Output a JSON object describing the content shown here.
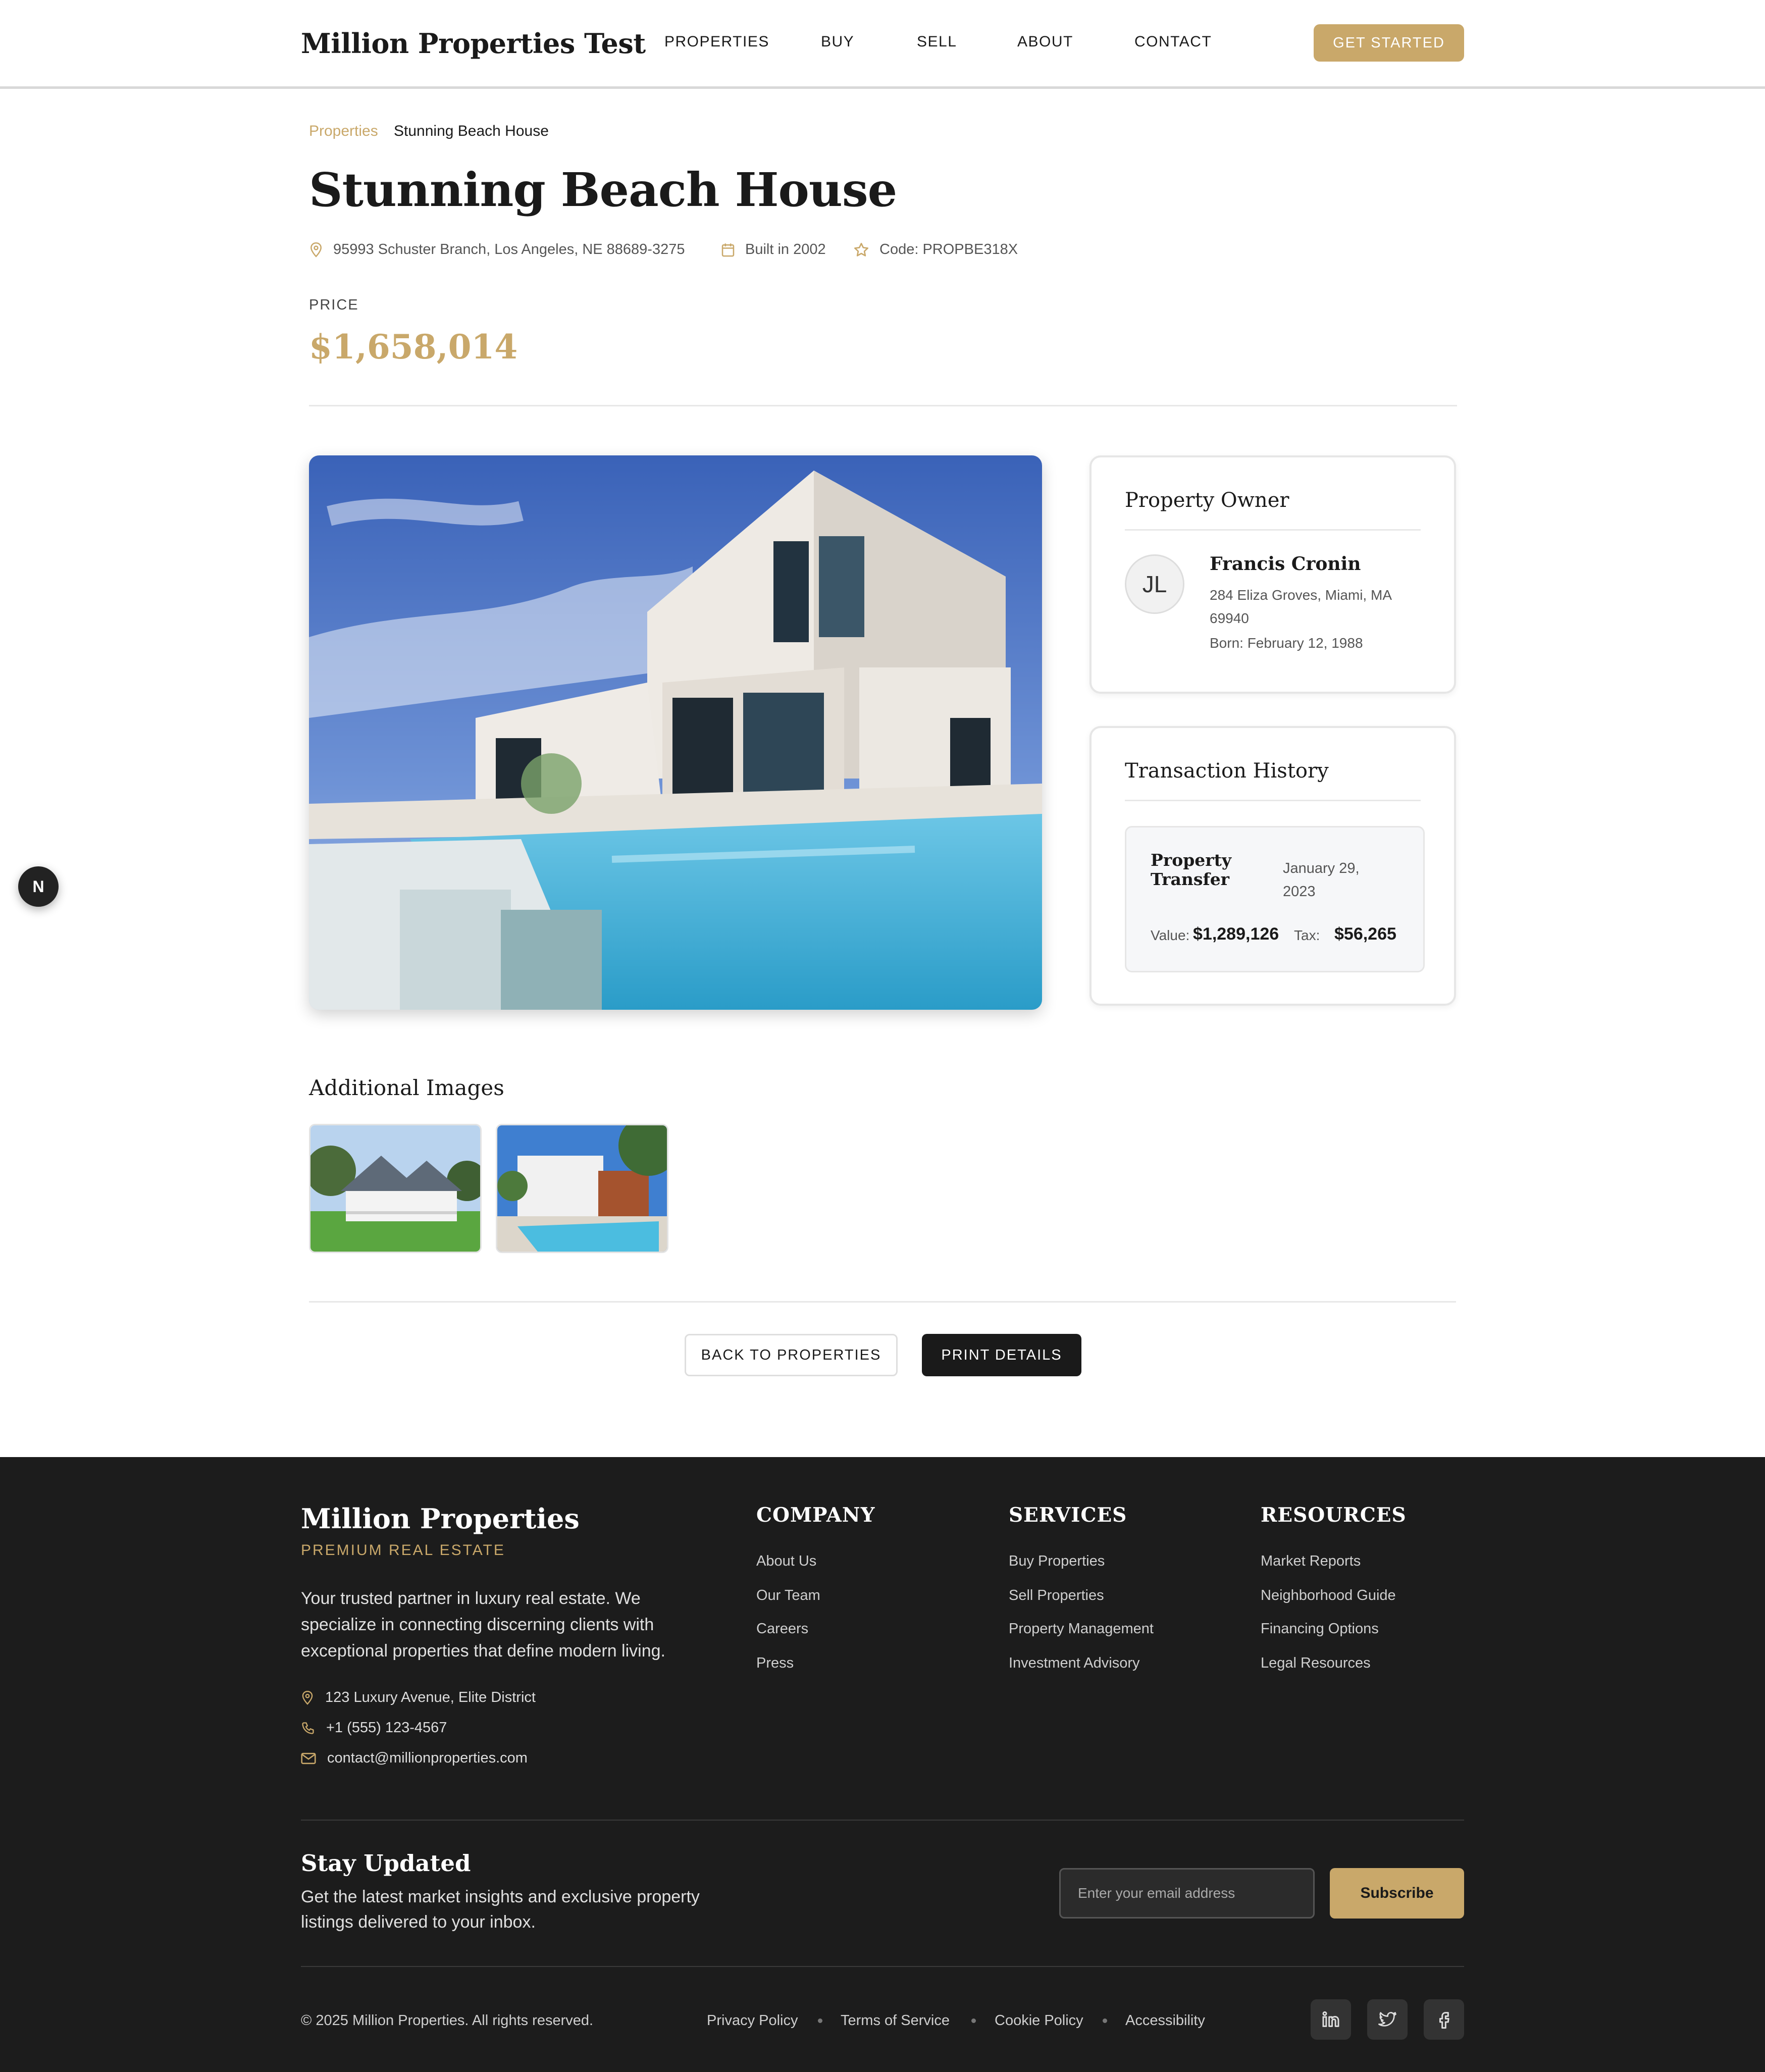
{
  "header": {
    "logo": "Million Properties Test",
    "nav": [
      "PROPERTIES",
      "BUY",
      "SELL",
      "ABOUT",
      "CONTACT"
    ],
    "cta": "GET STARTED"
  },
  "breadcrumb": {
    "parent": "Properties",
    "current": "Stunning Beach House"
  },
  "property": {
    "title": "Stunning Beach House",
    "address": "95993 Schuster Branch, Los Angeles, NE 88689-3275",
    "built": "Built in 2002",
    "code": "Code: PROPBE318X",
    "price_label": "PRICE",
    "price": "$1,658,014"
  },
  "side_badge": "N",
  "owner_card": {
    "heading": "Property Owner",
    "initials": "JL",
    "name": "Francis Cronin",
    "address": "284 Eliza Groves, Miami, MA 69940",
    "born": "Born: February 12, 1988"
  },
  "transactions": {
    "heading": "Transaction History",
    "items": [
      {
        "type": "Property Transfer",
        "date": "January 29, 2023",
        "value_label": "Value:",
        "value": "$1,289,126",
        "tax_label": "Tax:",
        "tax": "$56,265"
      }
    ]
  },
  "additional": {
    "heading": "Additional Images"
  },
  "actions": {
    "back": "BACK TO PROPERTIES",
    "print": "PRINT DETAILS"
  },
  "footer": {
    "brand": "Million Properties",
    "tagline": "PREMIUM REAL ESTATE",
    "description": "Your trusted partner in luxury real estate. We specialize in connecting discerning clients with exceptional properties that define modern living.",
    "address": "123 Luxury Avenue, Elite District",
    "phone": "+1 (555) 123-4567",
    "email": "contact@millionproperties.com",
    "columns": [
      {
        "heading": "COMPANY",
        "links": [
          "About Us",
          "Our Team",
          "Careers",
          "Press"
        ]
      },
      {
        "heading": "SERVICES",
        "links": [
          "Buy Properties",
          "Sell Properties",
          "Property Management",
          "Investment Advisory"
        ]
      },
      {
        "heading": "RESOURCES",
        "links": [
          "Market Reports",
          "Neighborhood Guide",
          "Financing Options",
          "Legal Resources"
        ]
      }
    ],
    "newsletter": {
      "heading": "Stay Updated",
      "text": "Get the latest market insights and exclusive property listings delivered to your inbox.",
      "placeholder": "Enter your email address",
      "button": "Subscribe"
    },
    "copyright": "© 2025 Million Properties. All rights reserved.",
    "legal": [
      "Privacy Policy",
      "Terms of Service",
      "Cookie Policy",
      "Accessibility"
    ],
    "social": [
      "linkedin-icon",
      "twitter-icon",
      "facebook-icon"
    ]
  },
  "colors": {
    "accent": "#c9a86a",
    "footer_bg": "#1c1c1c",
    "dark_button": "#1a1a1a"
  }
}
